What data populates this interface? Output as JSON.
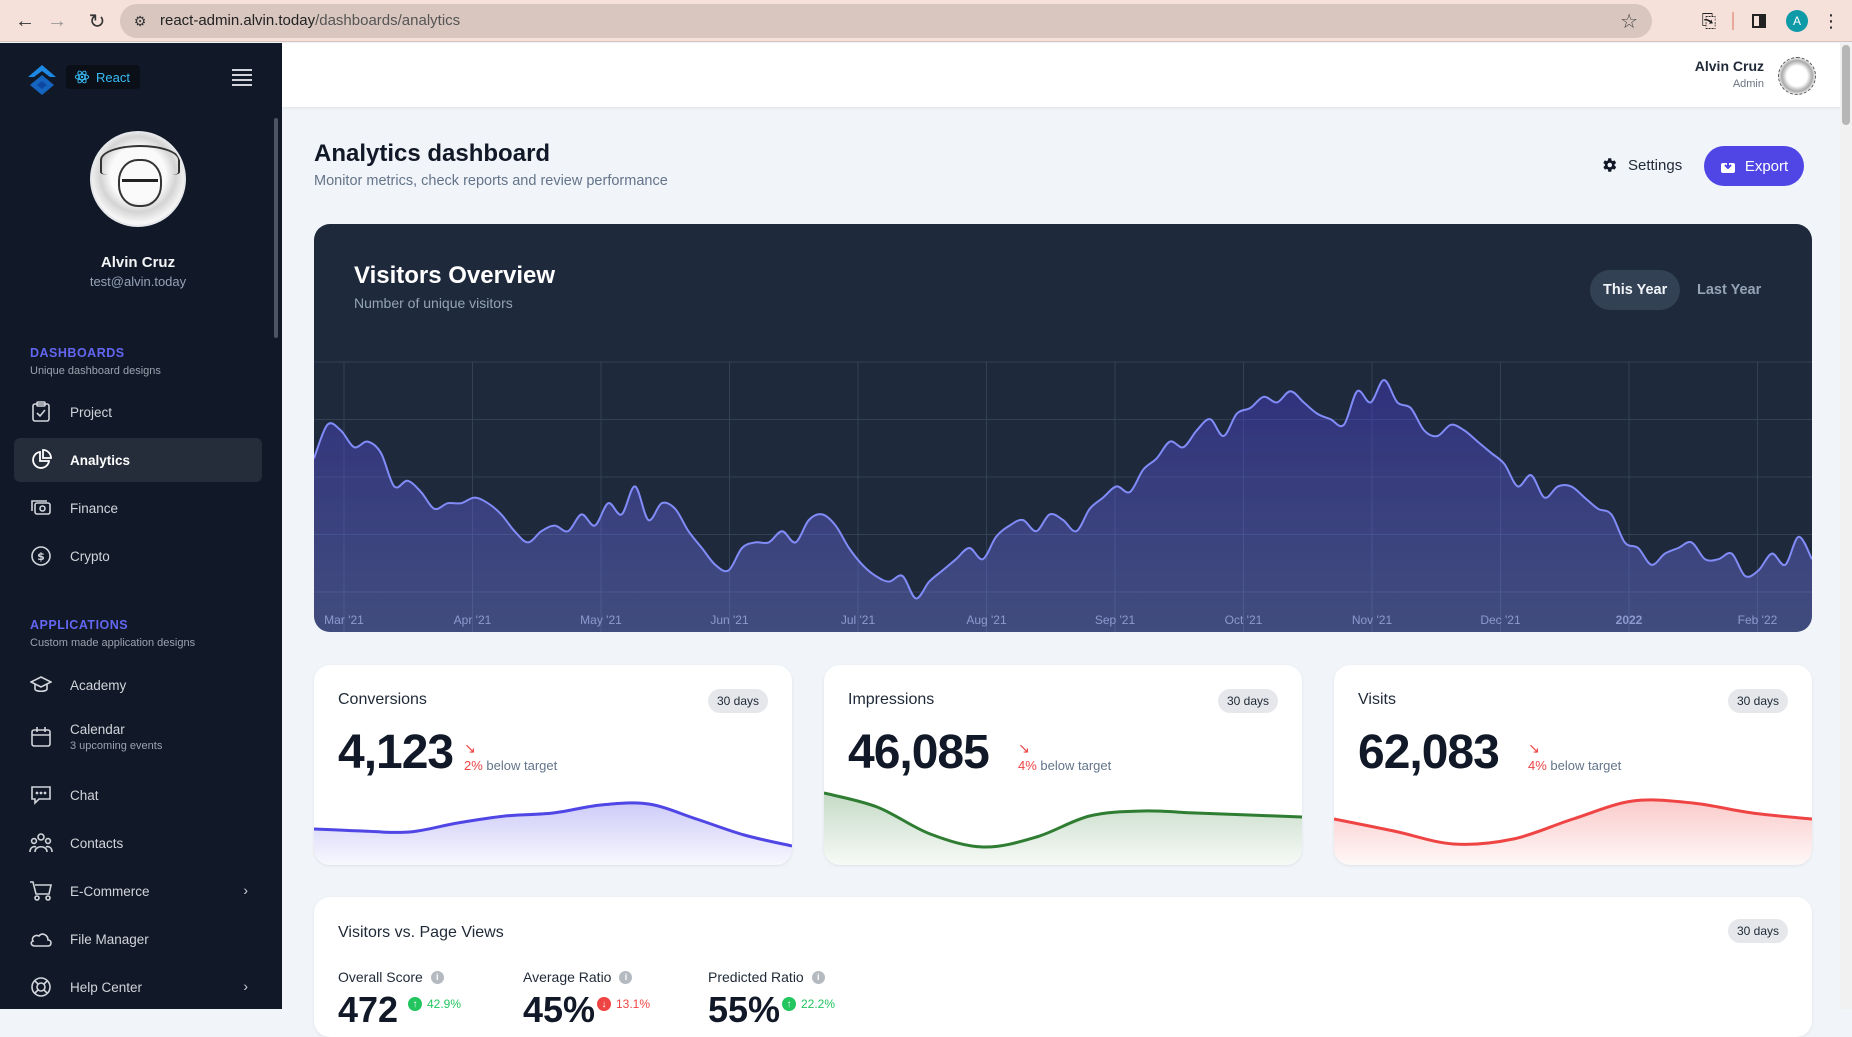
{
  "browser": {
    "url_host": "react-admin.alvin.today",
    "url_path": "/dashboards/analytics",
    "profile_initial": "A"
  },
  "sidebar": {
    "brand_badge": "React",
    "user": {
      "name": "Alvin Cruz",
      "email": "test@alvin.today"
    },
    "sections": [
      {
        "title": "DASHBOARDS",
        "subtitle": "Unique dashboard designs",
        "items": [
          {
            "label": "Project",
            "icon": "clipboard-check-icon"
          },
          {
            "label": "Analytics",
            "icon": "chart-pie-icon",
            "active": true
          },
          {
            "label": "Finance",
            "icon": "cash-icon"
          },
          {
            "label": "Crypto",
            "icon": "currency-dollar-icon"
          }
        ]
      },
      {
        "title": "APPLICATIONS",
        "subtitle": "Custom made application designs",
        "items": [
          {
            "label": "Academy",
            "icon": "academic-cap-icon"
          },
          {
            "label": "Calendar",
            "sublabel": "3 upcoming events",
            "icon": "calendar-icon"
          },
          {
            "label": "Chat",
            "icon": "chat-icon"
          },
          {
            "label": "Contacts",
            "icon": "user-group-icon"
          },
          {
            "label": "E-Commerce",
            "icon": "shopping-cart-icon",
            "has_children": true
          },
          {
            "label": "File Manager",
            "icon": "cloud-icon"
          },
          {
            "label": "Help Center",
            "icon": "support-icon",
            "has_children": true
          }
        ]
      }
    ]
  },
  "header": {
    "user_name": "Alvin Cruz",
    "user_role": "Admin"
  },
  "page": {
    "title": "Analytics dashboard",
    "subtitle": "Monitor metrics, check reports and review performance",
    "settings_label": "Settings",
    "export_label": "Export"
  },
  "visitors": {
    "title": "Visitors Overview",
    "subtitle": "Number of unique visitors",
    "tabs": [
      {
        "label": "This Year",
        "active": true
      },
      {
        "label": "Last Year",
        "active": false
      }
    ]
  },
  "chart_data": [
    {
      "type": "area",
      "title": "Visitors Overview",
      "subtitle": "Number of unique visitors",
      "x_tick_labels": [
        "Mar '21",
        "Apr '21",
        "May '21",
        "Jun '21",
        "Jul '21",
        "Aug '21",
        "Sep '21",
        "Oct '21",
        "Nov '21",
        "Dec '21",
        "2022",
        "Feb '22"
      ],
      "ylim": [
        0,
        5
      ],
      "grid": true,
      "series": [
        {
          "name": "Visitors",
          "color": "#818cf8",
          "values": [
            3.1,
            3.7,
            3.6,
            3.3,
            3.4,
            3.2,
            2.6,
            2.7,
            2.5,
            2.2,
            2.3,
            2.3,
            2.4,
            2.3,
            2.1,
            1.8,
            1.6,
            1.8,
            1.9,
            1.8,
            2.1,
            1.9,
            2.3,
            2.1,
            2.6,
            2.0,
            2.3,
            2.2,
            1.8,
            1.5,
            1.2,
            1.1,
            1.5,
            1.6,
            1.6,
            1.8,
            1.6,
            2.0,
            2.1,
            1.9,
            1.5,
            1.2,
            1.0,
            0.9,
            1.0,
            0.6,
            0.9,
            1.1,
            1.3,
            1.5,
            1.3,
            1.7,
            1.9,
            2.0,
            1.8,
            2.1,
            2.0,
            1.8,
            2.2,
            2.4,
            2.6,
            2.5,
            2.9,
            3.1,
            3.4,
            3.3,
            3.6,
            3.8,
            3.5,
            3.9,
            4.0,
            4.2,
            4.1,
            4.3,
            4.1,
            3.9,
            3.8,
            3.7,
            4.3,
            4.1,
            4.5,
            4.1,
            4.0,
            3.6,
            3.5,
            3.7,
            3.6,
            3.4,
            3.2,
            3.0,
            2.6,
            2.8,
            2.4,
            2.6,
            2.6,
            2.4,
            2.2,
            2.1,
            1.6,
            1.5,
            1.2,
            1.4,
            1.5,
            1.6,
            1.3,
            1.3,
            1.4,
            1.0,
            1.1,
            1.4,
            1.2,
            1.7,
            1.3
          ]
        }
      ]
    },
    {
      "type": "area",
      "title": "Conversions",
      "color": "#4f46e5",
      "values": [
        4.0,
        3.8,
        3.7,
        4.6,
        5.3,
        5.6,
        6.4,
        6.5,
        5.0,
        3.4,
        2.3
      ]
    },
    {
      "type": "area",
      "title": "Impressions",
      "color": "#2e7d32",
      "values": [
        7.6,
        6.2,
        3.5,
        2.2,
        3.2,
        5.3,
        5.8,
        5.6,
        5.4,
        5.2
      ]
    },
    {
      "type": "area",
      "title": "Visits",
      "color": "#ef4444",
      "values": [
        5.0,
        3.8,
        2.5,
        3.0,
        5.0,
        6.8,
        6.6,
        5.6,
        5.0
      ]
    }
  ],
  "stats": [
    {
      "title": "Conversions",
      "period": "30 days",
      "value": "4,123",
      "delta": "2%",
      "delta_text": "below target"
    },
    {
      "title": "Impressions",
      "period": "30 days",
      "value": "46,085",
      "delta": "4%",
      "delta_text": "below target"
    },
    {
      "title": "Visits",
      "period": "30 days",
      "value": "62,083",
      "delta": "4%",
      "delta_text": "below target"
    }
  ],
  "visitors_vs_pageviews": {
    "title": "Visitors vs. Page Views",
    "period": "30 days",
    "metrics": [
      {
        "label": "Overall Score",
        "value": "472",
        "change": "42.9%",
        "direction": "up"
      },
      {
        "label": "Average Ratio",
        "value": "45%",
        "change": "13.1%",
        "direction": "down"
      },
      {
        "label": "Predicted Ratio",
        "value": "55%",
        "change": "22.2%",
        "direction": "up"
      }
    ]
  }
}
